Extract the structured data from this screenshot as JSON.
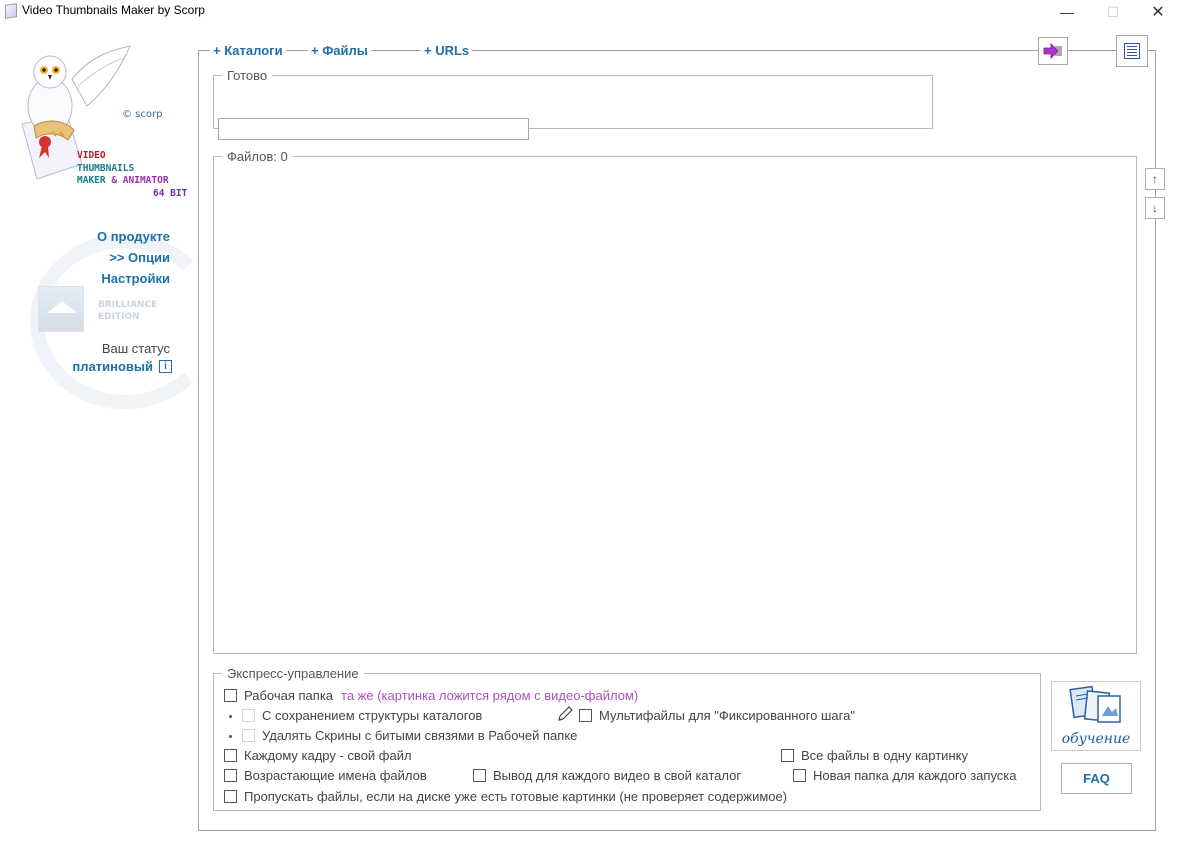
{
  "window": {
    "title": "Video Thumbnails Maker by Scorp",
    "minimize_glyph": "—",
    "maximize_glyph": "☐",
    "close_glyph": "✕"
  },
  "sidebar": {
    "copyright": "© scorp",
    "logo_lines": {
      "line1": "VIDEO",
      "line2": "THUMBNAILS",
      "line3a": "MAKER",
      "line3amp": " & ",
      "line3b": "ANIMATOR",
      "line4": "64 BIT"
    },
    "nav": {
      "about": "О продукте",
      "options": ">> Опции",
      "settings": "Настройки"
    },
    "brilliance": {
      "line1": "BRILLIANCE",
      "line2": "EDITION"
    },
    "status": {
      "label": "Ваш статус",
      "value": "платиновый",
      "info_glyph": "i"
    }
  },
  "tabs": {
    "catalogs": "+ Каталоги",
    "files": "+ Файлы",
    "urls": "+ URLs"
  },
  "ready_group": {
    "label": "Готово",
    "progress": 0
  },
  "files_group": {
    "label": "Файлов: 0",
    "up_glyph": "↑",
    "down_glyph": "↓"
  },
  "express": {
    "label": "Экспресс-управление",
    "work_folder": "Рабочая папка",
    "work_folder_value": "та же (картинка ложится рядом с видео-файлом)",
    "keep_structure": "С сохранением структуры каталогов",
    "multifiles": "Мультифайлы для \"Фиксированного шага\"",
    "delete_broken": "Удалять Скрины с битыми связями в Рабочей папке",
    "frame_per_file": "Каждому кадру - свой файл",
    "all_in_one": "Все файлы в одну картинку",
    "ascending_names": "Возрастающие имена файлов",
    "own_folder": "Вывод для каждого видео в свой каталог",
    "new_folder": "Новая папка для каждого запуска",
    "skip_existing": "Пропускать файлы, если на диске уже есть готовые картинки (не проверяет содержимое)"
  },
  "training": {
    "label": "обучение"
  },
  "faq": {
    "label": "FAQ"
  },
  "colors": {
    "link_blue": "#1f6fa8",
    "accent_purple": "#b04fc0",
    "logo_red": "#c0182b"
  }
}
